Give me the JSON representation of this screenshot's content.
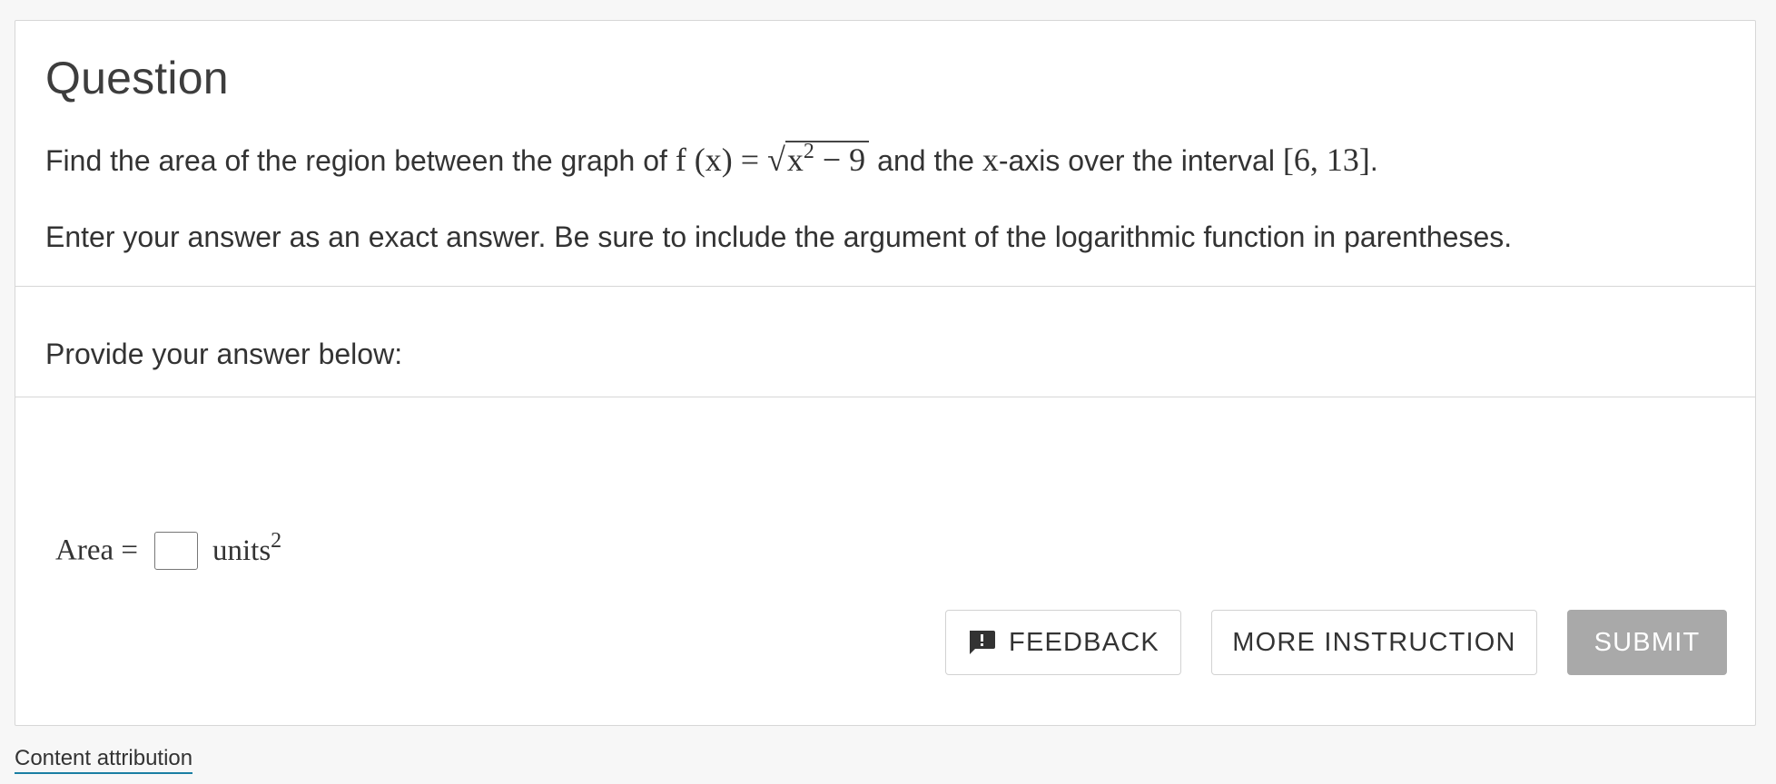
{
  "question": {
    "heading": "Question",
    "line1_before": "Find the area of the region between the graph of",
    "func_lhs": "f (x) = ",
    "radical": "√",
    "radicand_base": "x",
    "radicand_exp": "2",
    "radicand_rest": " − 9",
    "line1_mid": "and the",
    "axis_var": "x",
    "line1_after": "-axis over the interval",
    "interval": "[6, 13]",
    "period": ".",
    "instruction": "Enter your answer as an exact answer. Be sure to include the argument of the logarithmic function in parentheses."
  },
  "provide_label": "Provide your answer below:",
  "answer": {
    "label": "Area =",
    "value": "",
    "unit": "units",
    "unit_exp": "2"
  },
  "buttons": {
    "feedback": "FEEDBACK",
    "more_instruction": "MORE INSTRUCTION",
    "submit": "SUBMIT"
  },
  "footer": {
    "attribution": "Content attribution"
  },
  "colors": {
    "submit_disabled": "#a9a9a9",
    "link_underline": "#1a7fa3"
  }
}
